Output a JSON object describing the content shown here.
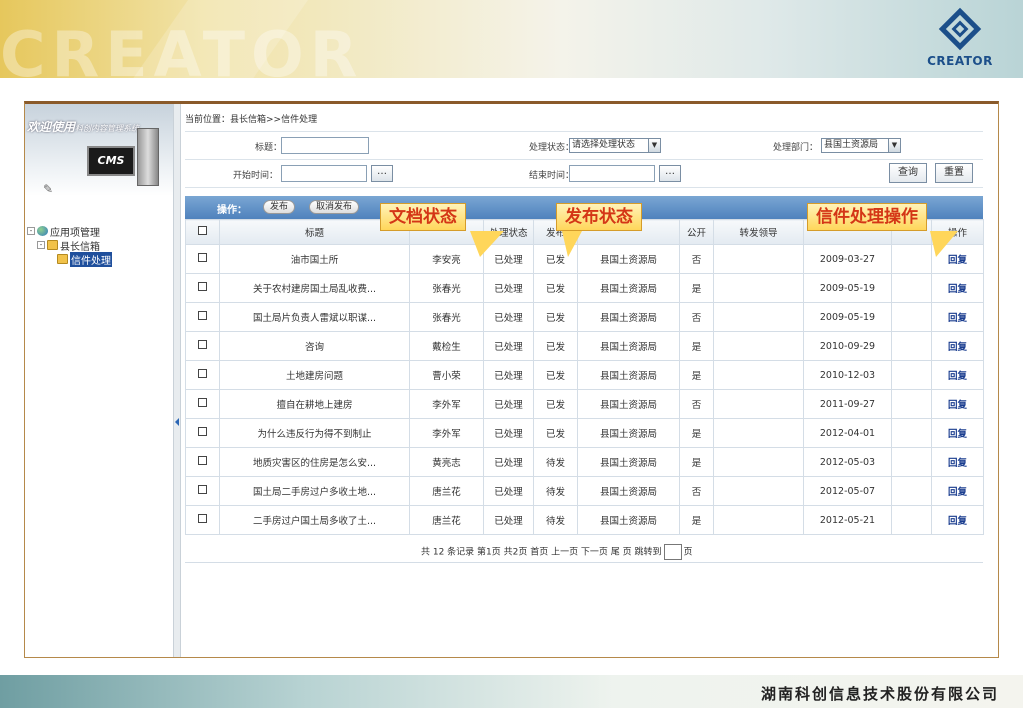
{
  "brand": {
    "banner_ghost_text": "CREATOR",
    "logo_text": "CREATOR",
    "company": "湖南科创信息技术股份有限公司"
  },
  "sidebar": {
    "welcome_title": "欢迎使用",
    "welcome_sub": "科创内容管理系统",
    "cms_label": "CMS",
    "tree": [
      {
        "label": "应用项管理",
        "toggle": "-"
      },
      {
        "label": "县长信箱",
        "toggle": "-"
      },
      {
        "label": "信件处理"
      }
    ]
  },
  "breadcrumb": "当前位置：县长信箱>>信件处理",
  "filters": {
    "title_label": "标题：",
    "status_label": "处理状态：",
    "status_value": "请选择处理状态",
    "dept_label": "处理部门：",
    "dept_value": "县国土资源局",
    "start_label": "开始时间：",
    "end_label": "结束时间：",
    "dots": "…",
    "search_button": "查询",
    "reset_button": "重置"
  },
  "toolbar": {
    "label": "操作：",
    "publish": "发布",
    "unpublish": "取消发布"
  },
  "table": {
    "headers": [
      "",
      "标题",
      "",
      "处理状态",
      "发布",
      "",
      "公开",
      "转发领导",
      "",
      "",
      "操作"
    ],
    "rows": [
      [
        "油市国土所",
        "李安亮",
        "已处理",
        "已发",
        "县国土资源局",
        "否",
        "",
        "2009-03-27",
        "回复"
      ],
      [
        "关于农村建房国土局乱收费...",
        "张春光",
        "已处理",
        "已发",
        "县国土资源局",
        "是",
        "",
        "2009-05-19",
        "回复"
      ],
      [
        "国土局片负责人雷斌以职谋...",
        "张春光",
        "已处理",
        "已发",
        "县国土资源局",
        "否",
        "",
        "2009-05-19",
        "回复"
      ],
      [
        "咨询",
        "戴检生",
        "已处理",
        "已发",
        "县国土资源局",
        "是",
        "",
        "2010-09-29",
        "回复"
      ],
      [
        "土地建房问题",
        "曹小荣",
        "已处理",
        "已发",
        "县国土资源局",
        "是",
        "",
        "2010-12-03",
        "回复"
      ],
      [
        "擅自在耕地上建房",
        "李外军",
        "已处理",
        "已发",
        "县国土资源局",
        "否",
        "",
        "2011-09-27",
        "回复"
      ],
      [
        "为什么违反行为得不到制止",
        "李外军",
        "已处理",
        "已发",
        "县国土资源局",
        "是",
        "",
        "2012-04-01",
        "回复"
      ],
      [
        "地质灾害区的住房是怎么安...",
        "黄亮志",
        "已处理",
        "待发",
        "县国土资源局",
        "是",
        "",
        "2012-05-03",
        "回复"
      ],
      [
        "国土局二手房过户多收土地...",
        "唐兰花",
        "已处理",
        "待发",
        "县国土资源局",
        "否",
        "",
        "2012-05-07",
        "回复"
      ],
      [
        "二手房过户国土局多收了土...",
        "唐兰花",
        "已处理",
        "待发",
        "县国土资源局",
        "是",
        "",
        "2012-05-21",
        "回复"
      ]
    ]
  },
  "pager": {
    "text": "共 12 条记录 第1页 共2页 首页   上一页   下一页   尾 页 跳转到",
    "suffix": "页"
  },
  "callouts": {
    "doc_status": "文档状态",
    "pub_status": "发布状态",
    "letter_ops": "信件处理操作"
  }
}
